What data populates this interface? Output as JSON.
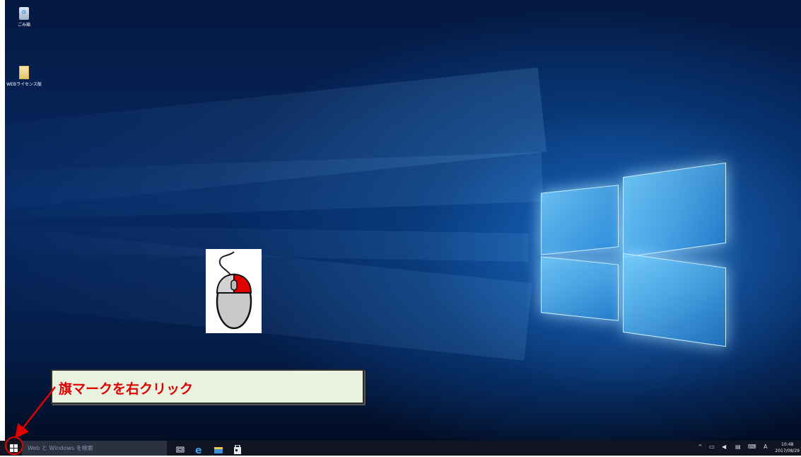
{
  "desktop": {
    "icons": [
      {
        "label": "ごみ箱",
        "icon": "recycle-bin-icon"
      },
      {
        "label": "WEBライセンス版",
        "icon": "document-file-icon"
      }
    ],
    "wallpaper": "windows-10-hero"
  },
  "callout": {
    "text_before": "旗マークを",
    "text_emphasis": "右クリック",
    "color": "#e00000",
    "background": "#e9f3df"
  },
  "taskbar": {
    "search_placeholder": "Web と Windows を検索",
    "pinned_icons": [
      "task-view-icon",
      "edge-icon",
      "file-explorer-icon",
      "store-icon"
    ],
    "tray": {
      "chevron": "^",
      "ime_indicator": "A"
    },
    "clock": {
      "time": "10:48",
      "date": "2017/08/29"
    }
  },
  "colors": {
    "highlight": "#e00000",
    "taskbar": "#101521"
  }
}
